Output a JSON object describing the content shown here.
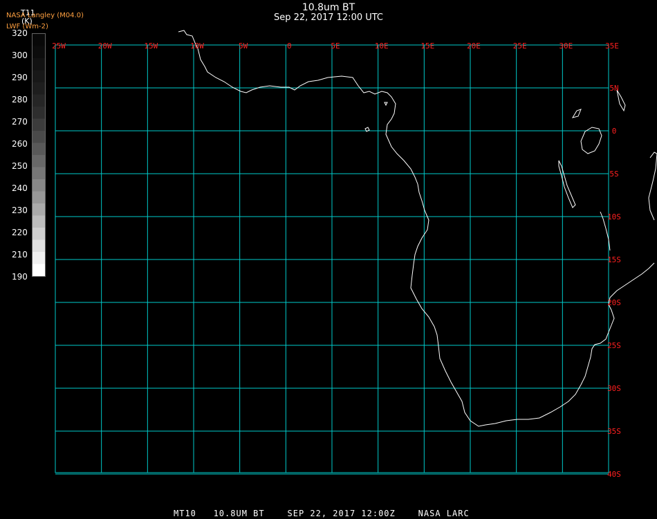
{
  "title": {
    "product": "10.8um BT",
    "datetime": "Sep 22, 2017 12:00 UTC"
  },
  "org": {
    "line1": "NASA Langley (M04.0)",
    "line2": "LWF (Wm-2)"
  },
  "colorbar": {
    "variable": "T11",
    "unit": "(K)",
    "ticks": [
      "320",
      "300",
      "290",
      "280",
      "270",
      "260",
      "250",
      "240",
      "230",
      "220",
      "210",
      "190"
    ],
    "colors": [
      "#ffffff",
      "#f0f0f0",
      "#e0e0e0",
      "#cfcfcf",
      "#bdbdbd",
      "#aaaaaa",
      "#989898",
      "#888888",
      "#777777",
      "#686868",
      "#595959",
      "#4a4a4a",
      "#3c3c3c",
      "#2e2e2e",
      "#262626",
      "#1e1e1e",
      "#181818",
      "#121212",
      "#0c0c0c",
      "#080808"
    ],
    "grid_color": "#00cccc",
    "label_color": "#ff2020",
    "coast_color": "#ffffff"
  },
  "map": {
    "longitudes": [
      "25W",
      "20W",
      "15W",
      "10W",
      "5W",
      "0",
      "5E",
      "10E",
      "15E",
      "20E",
      "25E",
      "30E",
      "35E"
    ],
    "latitudes": [
      "5N",
      "0",
      "5S",
      "10S",
      "15S",
      "20S",
      "25S",
      "30S",
      "35S",
      "40S"
    ]
  },
  "footer": "MT10   10.8UM BT    SEP 22, 2017 12:00Z    NASA LARC"
}
